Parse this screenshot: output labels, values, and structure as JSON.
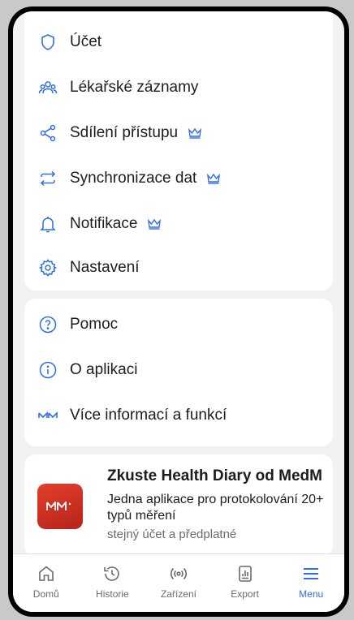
{
  "menu_primary": [
    {
      "label": "Účet",
      "icon": "shield-icon",
      "premium": false
    },
    {
      "label": "Lékařské záznamy",
      "icon": "people-icon",
      "premium": false
    },
    {
      "label": "Sdílení přístupu",
      "icon": "share-icon",
      "premium": true
    },
    {
      "label": "Synchronizace dat",
      "icon": "sync-icon",
      "premium": true
    },
    {
      "label": "Notifikace",
      "icon": "bell-icon",
      "premium": true
    },
    {
      "label": "Nastavení",
      "icon": "gear-icon",
      "premium": false
    }
  ],
  "menu_secondary": [
    {
      "label": "Pomoc",
      "icon": "help-circle-icon"
    },
    {
      "label": "O aplikaci",
      "icon": "info-circle-icon"
    },
    {
      "label": "Více informací a funkcí",
      "icon": "medm-logo-icon"
    }
  ],
  "promo": {
    "title": "Zkuste Health Diary od MedM",
    "description": "Jedna aplikace pro protokolování 20+ typů měření",
    "subtitle": "stejný účet a předplatné"
  },
  "tabs": [
    {
      "label": "Domů",
      "icon": "home-icon",
      "active": false
    },
    {
      "label": "Historie",
      "icon": "history-icon",
      "active": false
    },
    {
      "label": "Zařízení",
      "icon": "device-signal-icon",
      "active": false
    },
    {
      "label": "Export",
      "icon": "export-icon",
      "active": false
    },
    {
      "label": "Menu",
      "icon": "menu-icon",
      "active": true
    }
  ],
  "colors": {
    "accent": "#2f6fe0",
    "promo_red": "#d0322a",
    "background": "#f2f2f4"
  }
}
